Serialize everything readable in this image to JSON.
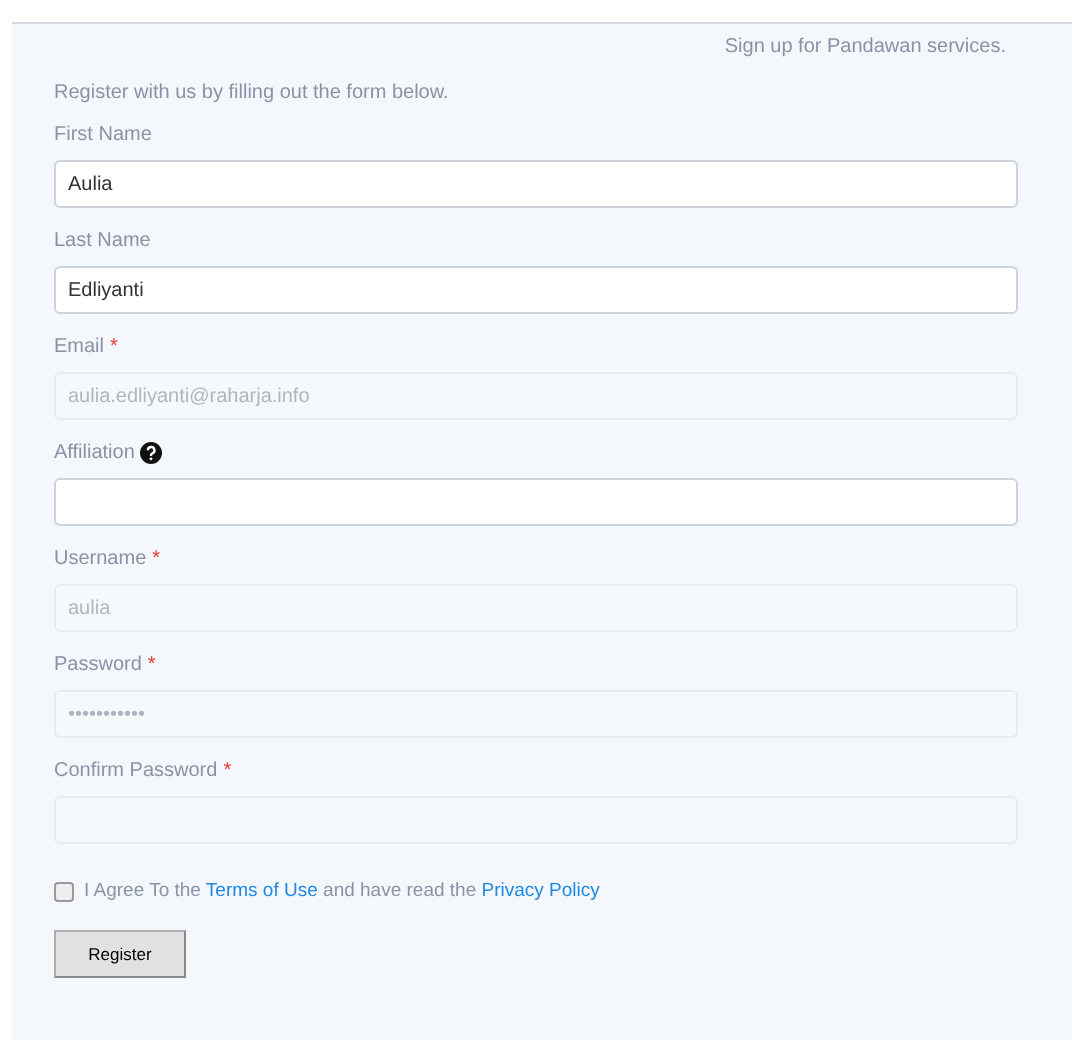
{
  "header": {
    "tagline": "Sign up for Pandawan services."
  },
  "intro": "Register with us by filling out the form below.",
  "fields": [
    {
      "label": "First Name",
      "value": "Aulia",
      "help": false,
      "disabled": false
    },
    {
      "label": "Last Name",
      "value": "Edliyanti",
      "help": false,
      "disabled": false
    },
    {
      "label": "Email",
      "required_mark": "*",
      "value": "aulia.edliyanti@raharja.info",
      "help": false,
      "disabled": true
    },
    {
      "label": "Affiliation",
      "help": true,
      "disabled": false
    },
    {
      "label": "Username",
      "required_mark": "*",
      "value": "aulia",
      "help": false,
      "disabled": true
    },
    {
      "label": "Password",
      "required_mark": "*",
      "value": "•••••••••••",
      "help": false,
      "disabled": true
    },
    {
      "label": "Confirm Password",
      "required_mark": "*",
      "help": false,
      "disabled": true
    }
  ],
  "agreement": {
    "checked": false,
    "parts": [
      {
        "kind": "text",
        "text": "I Agree To the "
      },
      {
        "kind": "link",
        "text": "Terms of Use"
      },
      {
        "kind": "text",
        "text": " and have read the "
      },
      {
        "kind": "link",
        "text": "Privacy Policy"
      }
    ]
  },
  "submit": {
    "label": "Register"
  }
}
